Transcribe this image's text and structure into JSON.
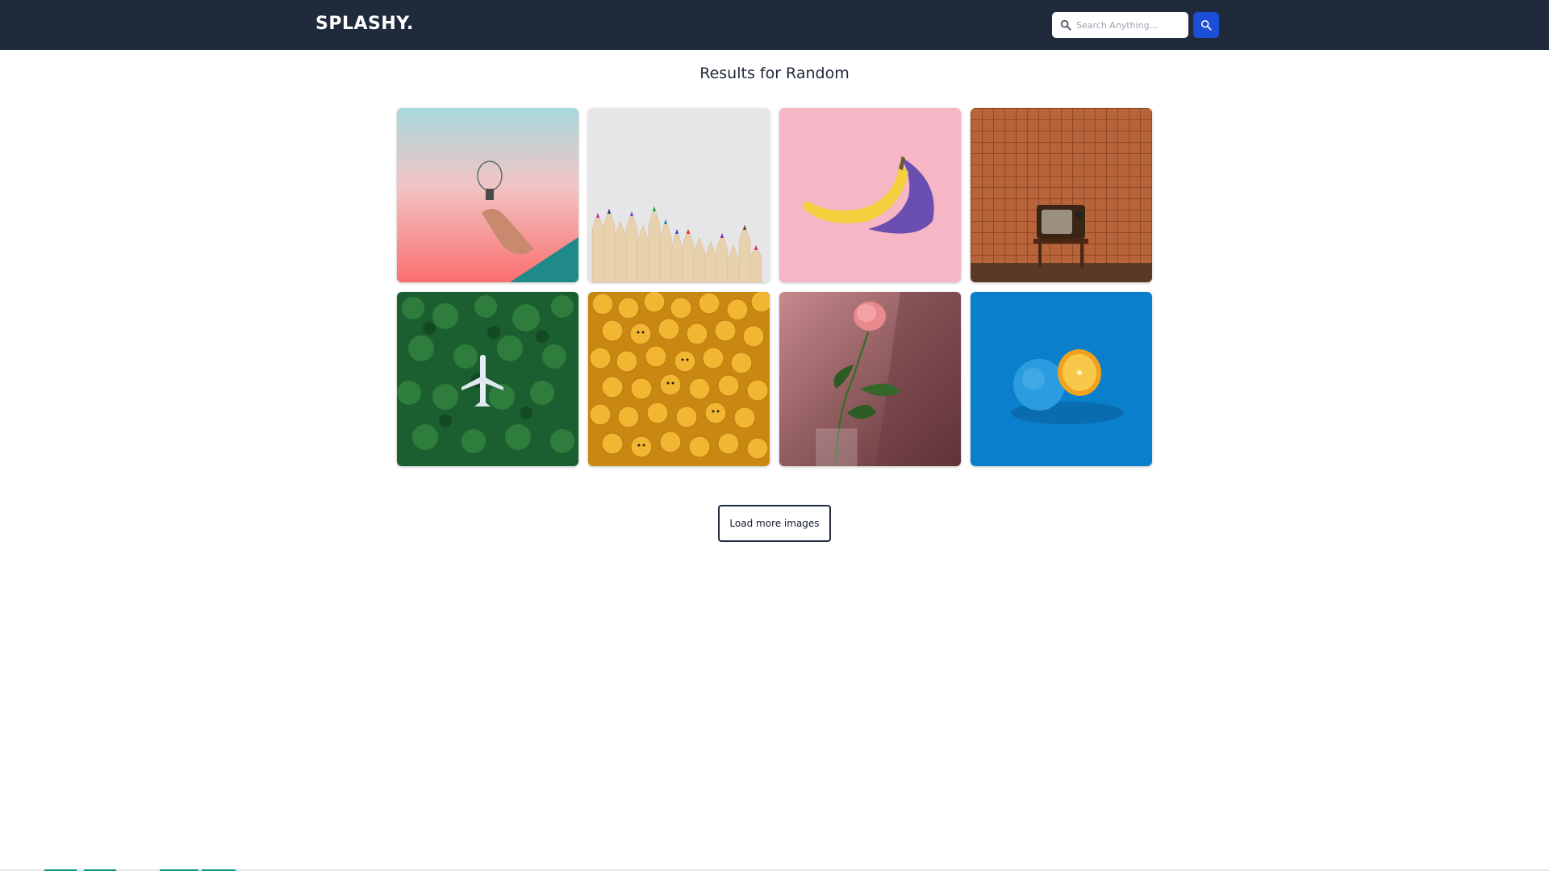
{
  "brand": {
    "logo_text": "SPLASHY."
  },
  "search": {
    "placeholder": "Search Anything...",
    "value": ""
  },
  "results": {
    "title": "Results for Random"
  },
  "images": [
    {
      "name": "lightbulb-in-hand-image"
    },
    {
      "name": "colored-pencils-image"
    },
    {
      "name": "banana-on-pink-image"
    },
    {
      "name": "retro-tv-on-stool-image"
    },
    {
      "name": "plane-in-forest-image"
    },
    {
      "name": "yellow-toy-heads-image"
    },
    {
      "name": "pink-rose-in-vase-image"
    },
    {
      "name": "blue-orange-fruit-image"
    }
  ],
  "buttons": {
    "load_more": "Load more images"
  },
  "colors": {
    "navbar": "#1f2a3d",
    "search_button": "#1d4ed8",
    "page_bg": "#ffffff"
  }
}
